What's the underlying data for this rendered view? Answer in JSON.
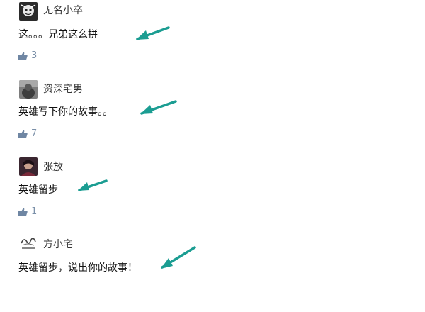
{
  "comments": [
    {
      "username": "无名小卒",
      "content": "这。。。兄弟这么拼",
      "likes": "3",
      "avatar_icon": "avatar-dark-cartoon"
    },
    {
      "username": "资深宅男",
      "content": "英雄写下你的故事。。",
      "likes": "7",
      "avatar_icon": "avatar-gray-figure"
    },
    {
      "username": "张放",
      "content": "英雄留步",
      "likes": "1",
      "avatar_icon": "avatar-dark-portrait"
    },
    {
      "username": "方小宅",
      "content": "英雄留步，说出你的故事！",
      "likes": "",
      "avatar_icon": "avatar-sketch-logo"
    }
  ],
  "colors": {
    "arrow": "#1b9d92",
    "like_icon": "#6f86a3",
    "like_text": "#7a8fa8",
    "divider": "#ececec"
  },
  "icons": {
    "like": "thumbs-up-icon",
    "annotation": "teal-arrow-icon"
  }
}
